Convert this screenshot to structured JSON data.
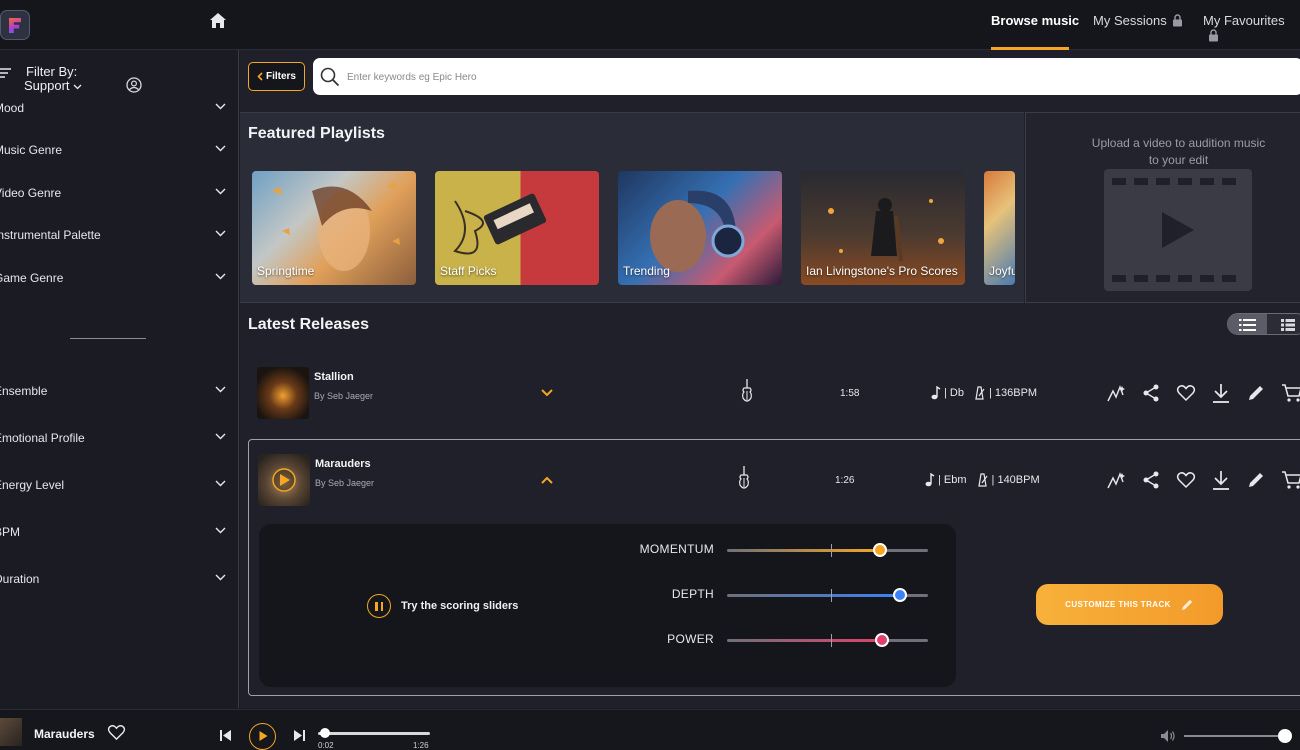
{
  "topbar": {
    "nav": [
      "Browse music",
      "My Sessions",
      "My Favourites"
    ]
  },
  "sidebar": {
    "filter_by": "Filter By:",
    "support": "Support",
    "items_top": [
      "Mood",
      "Music Genre",
      "Video Genre",
      "Instrumental Palette",
      "Game Genre"
    ],
    "items_bottom": [
      "Ensemble",
      "Emotional Profile",
      "Energy Level",
      "BPM",
      "Duration"
    ]
  },
  "search": {
    "filters_label": "Filters",
    "placeholder": "Enter keywords eg Epic Hero"
  },
  "featured": {
    "title": "Featured Playlists",
    "playlists": [
      "Springtime",
      "Staff Picks",
      "Trending",
      "Ian Livingstone's Pro Scores",
      "Joyful"
    ]
  },
  "upload": {
    "text": "Upload a video to audition music to your edit"
  },
  "latest": {
    "title": "Latest Releases",
    "tracks": [
      {
        "name": "Stallion",
        "artist": "By Seb Jaeger",
        "duration": "1:58",
        "key": "| Db",
        "bpm": "| 136BPM"
      },
      {
        "name": "Marauders",
        "artist": "By Seb Jaeger",
        "duration": "1:26",
        "key": "| Ebm",
        "bpm": "| 140BPM"
      }
    ]
  },
  "sliders": {
    "try_label": "Try the scoring sliders",
    "items": [
      {
        "label": "MOMENTUM",
        "value": 0.76,
        "color": "#f5a623"
      },
      {
        "label": "DEPTH",
        "value": 0.86,
        "color": "#3b82f6"
      },
      {
        "label": "POWER",
        "value": 0.77,
        "color": "#e0426b"
      }
    ],
    "customize_label": "CUSTOMIZE THIS TRACK"
  },
  "player": {
    "title": "Marauders",
    "elapsed": "0:02",
    "total": "1:26",
    "progress": 0.02,
    "volume": 0.95
  },
  "colors": {
    "accent": "#f5a623",
    "background": "#1b1c23"
  }
}
